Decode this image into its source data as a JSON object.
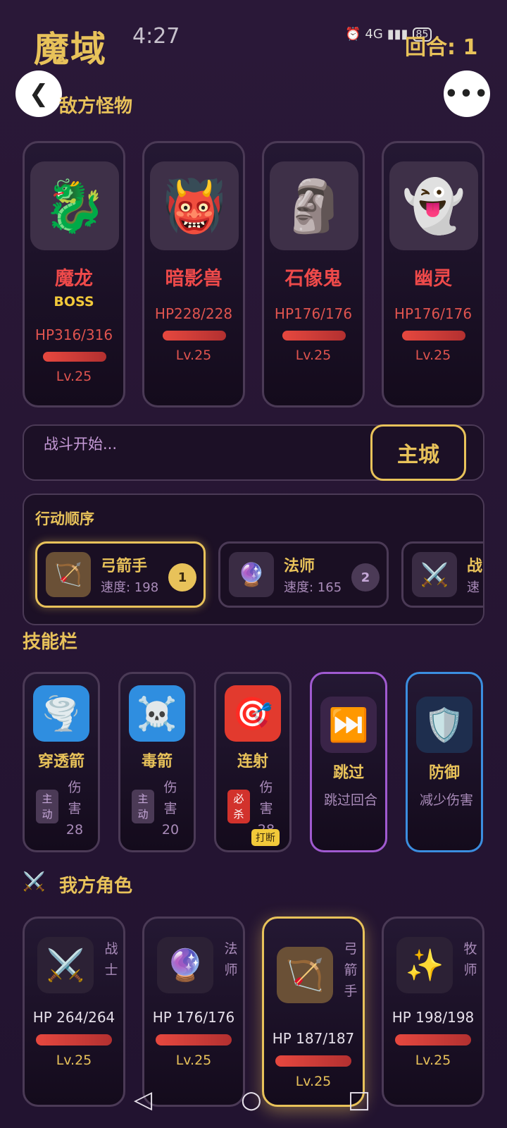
{
  "header": {
    "title": "魔域",
    "clock": "4:27",
    "network": "4G",
    "battery": "85",
    "round": "回合: 1"
  },
  "enemies_section": {
    "title": "敌方怪物"
  },
  "enemies": [
    {
      "icon": "dragon-icon",
      "glyph": "🐉",
      "name": "魔龙",
      "badge": "BOSS",
      "hp": "HP316/316",
      "level": "Lv.25",
      "hp_fraction": 1
    },
    {
      "icon": "demon-icon",
      "glyph": "👹",
      "name": "暗影兽",
      "badge": "",
      "hp": "HP228/228",
      "level": "Lv.25",
      "hp_fraction": 1
    },
    {
      "icon": "moai-icon",
      "glyph": "🗿",
      "name": "石像鬼",
      "badge": "",
      "hp": "HP176/176",
      "level": "Lv.25",
      "hp_fraction": 1
    },
    {
      "icon": "ghost-icon",
      "glyph": "👻",
      "name": "幽灵",
      "badge": "",
      "hp": "HP176/176",
      "level": "Lv.25",
      "hp_fraction": 1
    }
  ],
  "battle_log": {
    "text": "战斗开始...",
    "main_city_label": "主城"
  },
  "action_order": {
    "title": "行动顺序",
    "items": [
      {
        "icon": "bow-icon",
        "glyph": "🏹",
        "name": "弓箭手",
        "speed": "速度: 198",
        "order": "1"
      },
      {
        "icon": "crystal-ball-icon",
        "glyph": "🔮",
        "name": "法师",
        "speed": "速度: 165",
        "order": "2"
      },
      {
        "icon": "swords-icon",
        "glyph": "⚔️",
        "name": "战",
        "speed": "速",
        "order": ""
      }
    ]
  },
  "skills_section": {
    "title": "技能栏"
  },
  "skills": [
    {
      "icon": "tornado-icon",
      "glyph": "🌪️",
      "name": "穿透箭",
      "tag": "主动",
      "desc": "伤害28"
    },
    {
      "icon": "skull-icon",
      "glyph": "☠️",
      "name": "毒箭",
      "tag": "主动",
      "desc": "伤害20"
    },
    {
      "icon": "target-icon",
      "glyph": "🎯",
      "name": "连射",
      "tag": "必杀",
      "desc": "伤害28",
      "badge": "打断"
    },
    {
      "icon": "skip-icon",
      "glyph": "⏭️",
      "name": "跳过",
      "desc": "跳过回合"
    },
    {
      "icon": "shield-icon",
      "glyph": "🛡️",
      "name": "防御",
      "desc": "减少伤害"
    }
  ],
  "allies_section": {
    "title": "我方角色",
    "icon": "swords-icon"
  },
  "allies": [
    {
      "icon": "swords-icon",
      "glyph": "⚔️",
      "role": "战士",
      "hp": "HP 264/264",
      "level": "Lv.25",
      "hp_fraction": 1
    },
    {
      "icon": "crystal-ball-icon",
      "glyph": "🔮",
      "role": "法师",
      "hp": "HP 176/176",
      "level": "Lv.25",
      "hp_fraction": 1
    },
    {
      "icon": "bow-icon",
      "glyph": "🏹",
      "role": "弓箭手",
      "hp": "HP 187/187",
      "level": "Lv.25",
      "hp_fraction": 1
    },
    {
      "icon": "sparkles-icon",
      "glyph": "✨",
      "role": "牧师",
      "hp": "HP 198/198",
      "level": "Lv.25",
      "hp_fraction": 1
    }
  ],
  "colors": {
    "accent": "#e8c25a",
    "enemy_red": "#ef4a4a",
    "background": "#271634"
  }
}
